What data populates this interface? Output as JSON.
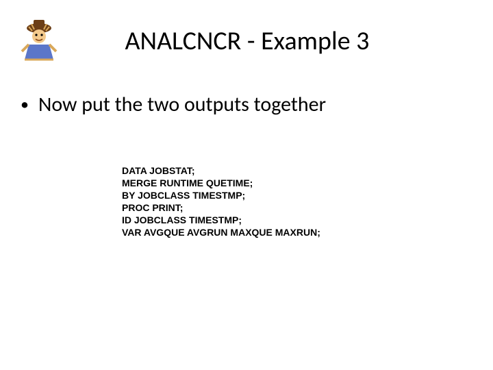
{
  "title": "ANALCNCR - Example 3",
  "bullet": "Now put the two outputs together",
  "code": {
    "l1": "DATA JOBSTAT;",
    "l2": "MERGE RUNTIME QUETIME;",
    "l3": "BY JOBCLASS TIMESTMP;",
    "l4": "PROC PRINT;",
    "l5": "ID JOBCLASS TIMESTMP;",
    "l6": "VAR AVGQUE AVGRUN MAXQUE MAXRUN;"
  },
  "logo_alt": "cartoon-scarecrow"
}
